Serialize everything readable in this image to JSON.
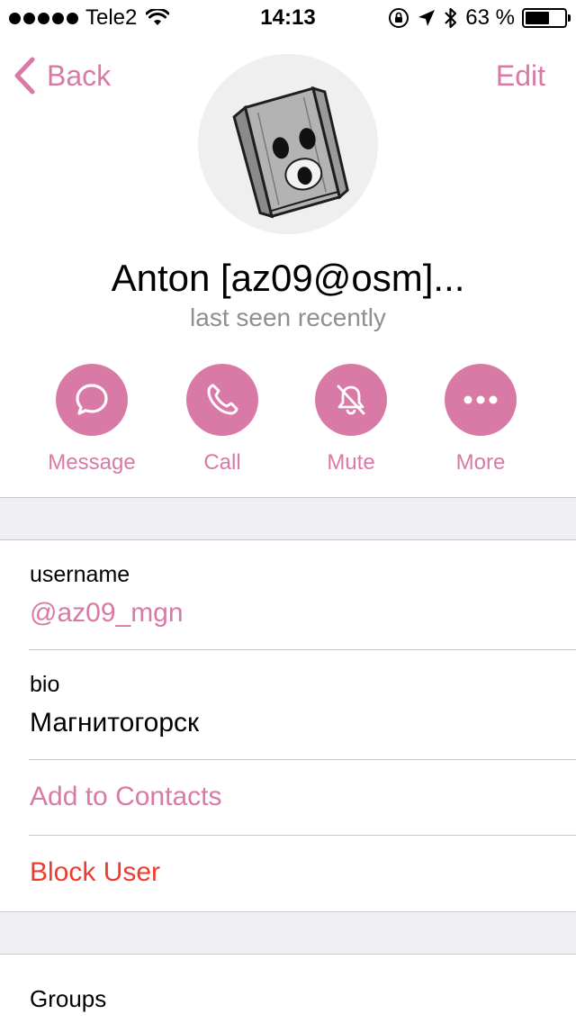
{
  "status_bar": {
    "carrier": "Tele2",
    "time": "14:13",
    "battery_percent": "63 %",
    "battery_level": 0.63
  },
  "nav": {
    "back_label": "Back",
    "edit_label": "Edit"
  },
  "profile": {
    "name": "Anton [az09@osm]...",
    "status": "last seen recently"
  },
  "actions": [
    {
      "label": "Message",
      "icon": "chat-bubble-icon"
    },
    {
      "label": "Call",
      "icon": "phone-icon"
    },
    {
      "label": "Mute",
      "icon": "bell-slash-icon"
    },
    {
      "label": "More",
      "icon": "ellipsis-icon"
    }
  ],
  "info": {
    "username_label": "username",
    "username_value": "@az09_mgn",
    "bio_label": "bio",
    "bio_value": "Магнитогорск",
    "add_contacts": "Add to Contacts",
    "block_user": "Block User"
  },
  "groups": {
    "label": "Groups"
  },
  "colors": {
    "accent": "#d97aa6",
    "destructive": "#ef3b2f",
    "secondary_text": "#8e8e93",
    "group_background": "#efeff4"
  }
}
